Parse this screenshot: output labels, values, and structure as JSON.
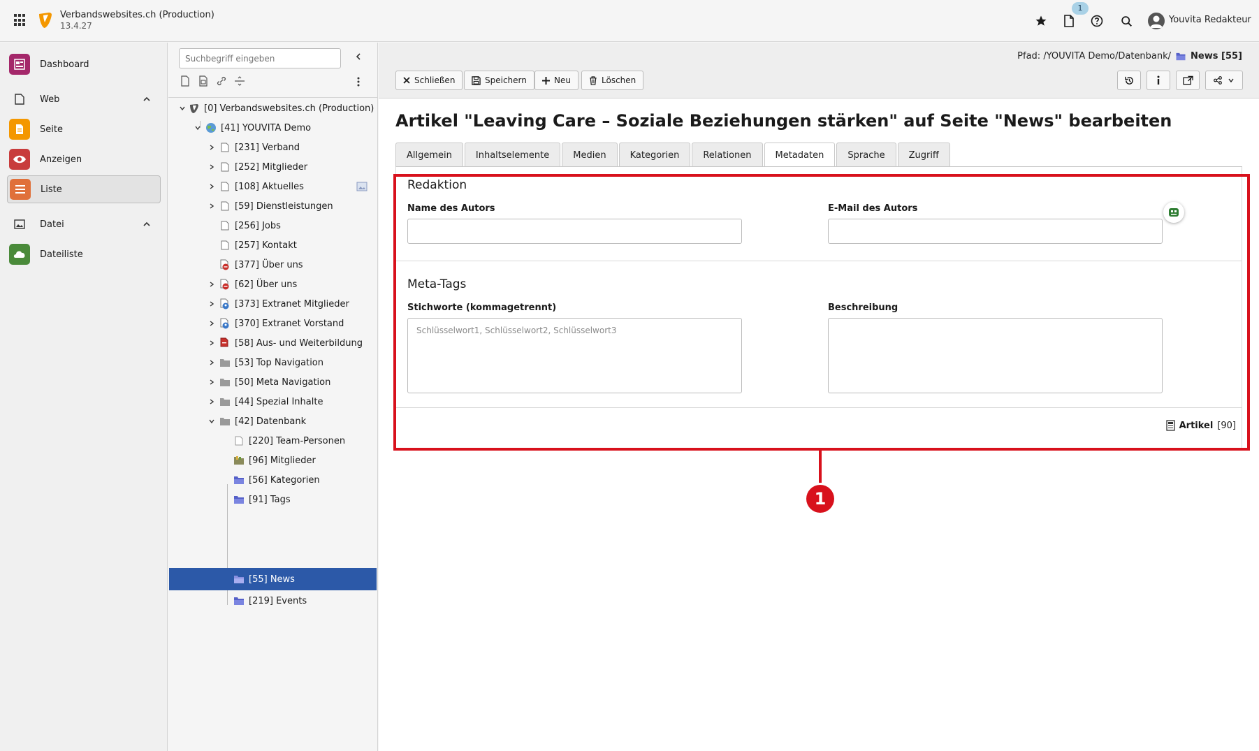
{
  "topbar": {
    "site_title": "Verbandswebsites.ch (Production)",
    "version": "13.4.27",
    "notification_count": "1",
    "user_name": "Youvita Redakteur"
  },
  "modules": {
    "dashboard": "Dashboard",
    "web": "Web",
    "seite": "Seite",
    "anzeigen": "Anzeigen",
    "liste": "Liste",
    "datei": "Datei",
    "dateiliste": "Dateiliste"
  },
  "tree": {
    "search_placeholder": "Suchbegriff eingeben",
    "nodes": [
      "[0] Verbandswebsites.ch (Production)",
      "[41] YOUVITA Demo",
      "[231] Verband",
      "[252] Mitglieder",
      "[108] Aktuelles",
      "[59] Dienstleistungen",
      "[256] Jobs",
      "[257] Kontakt",
      "[377] Über uns",
      "[62] Über uns",
      "[373] Extranet Mitglieder",
      "[370] Extranet Vorstand",
      "[58] Aus- und Weiterbildung",
      "[53] Top Navigation",
      "[50] Meta Navigation",
      "[44] Spezial Inhalte",
      "[42] Datenbank",
      "[220] Team-Personen",
      "[96] Mitglieder",
      "[56] Kategorien",
      "[91] Tags",
      "[55] News",
      "[219] Events"
    ]
  },
  "docheader": {
    "path_label": "Pfad: /YOUVITA Demo/Datenbank/",
    "path_current": "News [55]",
    "buttons": {
      "close": "Schließen",
      "save": "Speichern",
      "new": "Neu",
      "delete": "Löschen"
    }
  },
  "editor": {
    "title": "Artikel \"Leaving Care – Soziale Beziehungen stärken\" auf Seite \"News\" bearbeiten",
    "tabs": [
      "Allgemein",
      "Inhaltselemente",
      "Medien",
      "Kategorien",
      "Relationen",
      "Metadaten",
      "Sprache",
      "Zugriff"
    ],
    "active_tab": "Metadaten",
    "section_redaktion": "Redaktion",
    "label_author_name": "Name des Autors",
    "label_author_email": "E-Mail des Autors",
    "section_meta": "Meta-Tags",
    "label_keywords": "Stichworte (kommagetrennt)",
    "keywords_placeholder": "Schlüsselwort1, Schlüsselwort2, Schlüsselwort3",
    "label_description": "Beschreibung",
    "footer_record_type": "Artikel",
    "footer_record_id": "[90]"
  },
  "annotation": {
    "number": "1",
    "color": "#d8111c"
  },
  "colors": {
    "selected_node": "#2c59a8",
    "typo3_orange": "#f49700"
  }
}
